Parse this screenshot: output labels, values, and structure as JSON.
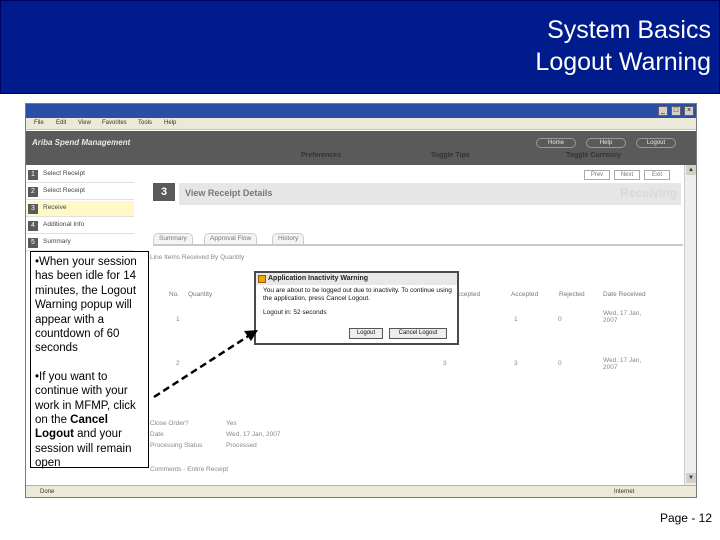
{
  "slide": {
    "title_line1": "System Basics",
    "title_line2": "Logout Warning",
    "page_number": "Page - 12"
  },
  "browser": {
    "menus": [
      "File",
      "Edit",
      "View",
      "Favorites",
      "Tools",
      "Help"
    ],
    "status_text": "Done",
    "zone_text": "Internet"
  },
  "app": {
    "title": "Ariba Spend Management",
    "header_buttons": [
      "Home",
      "Help",
      "Logout"
    ],
    "header_links": [
      "Preferences",
      "Toggle Tips",
      "Toggle Currency"
    ]
  },
  "steps": [
    {
      "num": "1",
      "label": "Select Receipt"
    },
    {
      "num": "2",
      "label": "Select Receipt"
    },
    {
      "num": "3",
      "label": "Receive"
    },
    {
      "num": "4",
      "label": "Additional Info"
    },
    {
      "num": "5",
      "label": "Summary"
    }
  ],
  "receipt": {
    "nav_buttons": [
      "Prev",
      "Next",
      "Exit"
    ],
    "step_number": "3",
    "step_heading": "View Receipt Details",
    "step_watermark": "Receiving",
    "tabs": [
      "Summary",
      "Approval Flow",
      "History"
    ],
    "section_title": "Line Items Received By Quantity",
    "columns": [
      "No.",
      "Quantity",
      "Accepted",
      "Accepted",
      "Rejected",
      "Date Received"
    ],
    "rows": [
      {
        "no": "1",
        "quantity": "1",
        "accepted": "1",
        "rejected": "0",
        "date": "Wed, 17 Jan, 2007"
      },
      {
        "no": "2",
        "quantity": "3",
        "accepted": "3",
        "rejected": "0",
        "date": "Wed, 17 Jan, 2007"
      }
    ],
    "details": [
      {
        "label": "Close Order?",
        "value": "Yes"
      },
      {
        "label": "Date",
        "value": "Wed, 17 Jan, 2007"
      },
      {
        "label": "Processing Status",
        "value": "Processed"
      }
    ],
    "comments_title": "Comments - Entire Receipt"
  },
  "dialog": {
    "title": "Application Inactivity Warning",
    "message": "You are about to be logged out due to inactivity. To continue using the application, press Cancel Logout.",
    "countdown": "Logout in: 52 seconds",
    "logout_label": "Logout",
    "cancel_label": "Cancel Logout"
  },
  "callout": {
    "bullet1": "•When your session has been idle for 14 minutes, the Logout Warning popup will appear with a countdown of 60 seconds",
    "bullet2_pre": "•If you want to continue with your work in MFMP, click on the ",
    "bullet2_bold": "Cancel Logout",
    "bullet2_post": " and your session will remain open"
  },
  "colors": {
    "banner": "#001c8c",
    "title_text": "#ffffff",
    "app_header": "#5a5a5a",
    "active_step": "#fff8c8"
  }
}
